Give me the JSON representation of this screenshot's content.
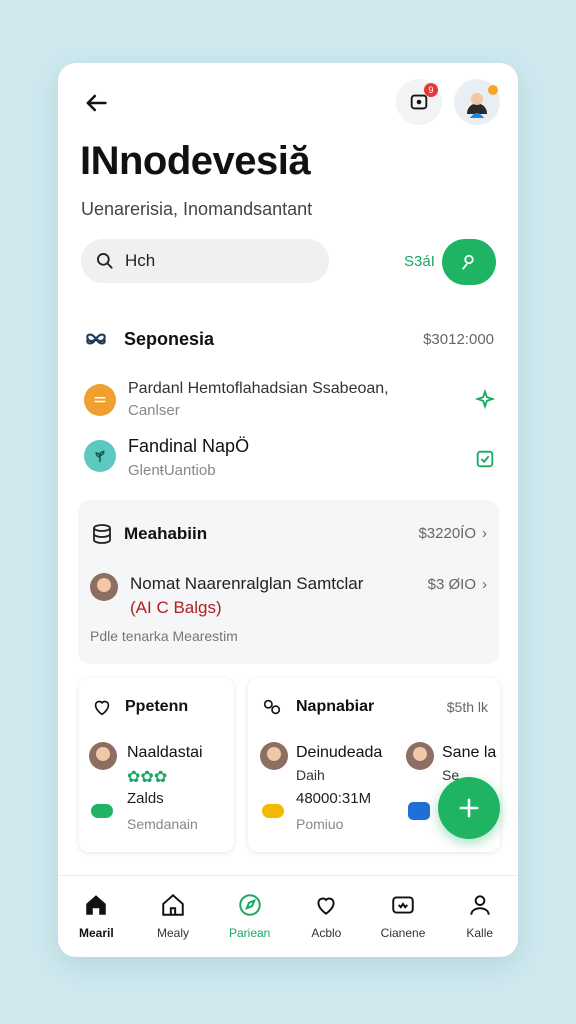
{
  "header": {
    "notif_count": "9"
  },
  "title": "INnodevesiă",
  "subtitle": "Uenarerisia, Inomandsantant",
  "search": {
    "placeholder": "Hch",
    "side_text": "S3áI"
  },
  "section1": {
    "title": "Seponesia",
    "value": "$3012:000",
    "items": [
      {
        "line1": "Pardanl Hemtoflahadsian Ssabeoan,",
        "line2": "Canlser",
        "dot_color": "#f0a030"
      },
      {
        "line1": "Fandinal NapÖ",
        "line2": "GlenŧUantiob",
        "dot_color": "#5cc8c0"
      }
    ]
  },
  "section2": {
    "title": "Meahabiin",
    "value": "$3220ÍO",
    "row_title": "Nomat Naarenralglan Samtclar",
    "row_tag": "(AI C Balgs)",
    "row_value": "$3 ØIO",
    "footer": "Pdle tenarka Mearestim"
  },
  "card_left": {
    "title": "Ppetenn",
    "name": "Naaldastai",
    "stars": "✿✿✿",
    "label": "Zalds",
    "footer": "Semdanain"
  },
  "card_right": {
    "title": "Napnabiar",
    "value": "$5th lk",
    "name": "Deinudeada",
    "sub": "Daih",
    "amount": "48000:31M",
    "footer": "Pomiuo",
    "name2": "Sane la",
    "sub2": "Se"
  },
  "nav": [
    {
      "label": "Mearil",
      "icon": "home-icon"
    },
    {
      "label": "Mealy",
      "icon": "house-outline-icon"
    },
    {
      "label": "Pariean",
      "icon": "compass-icon"
    },
    {
      "label": "Acblo",
      "icon": "heart-icon"
    },
    {
      "label": "Cianene",
      "icon": "tv-icon"
    },
    {
      "label": "Kalle",
      "icon": "profile-icon"
    }
  ],
  "colors": {
    "accent": "#1fb464",
    "background": "#cfe9ef"
  }
}
